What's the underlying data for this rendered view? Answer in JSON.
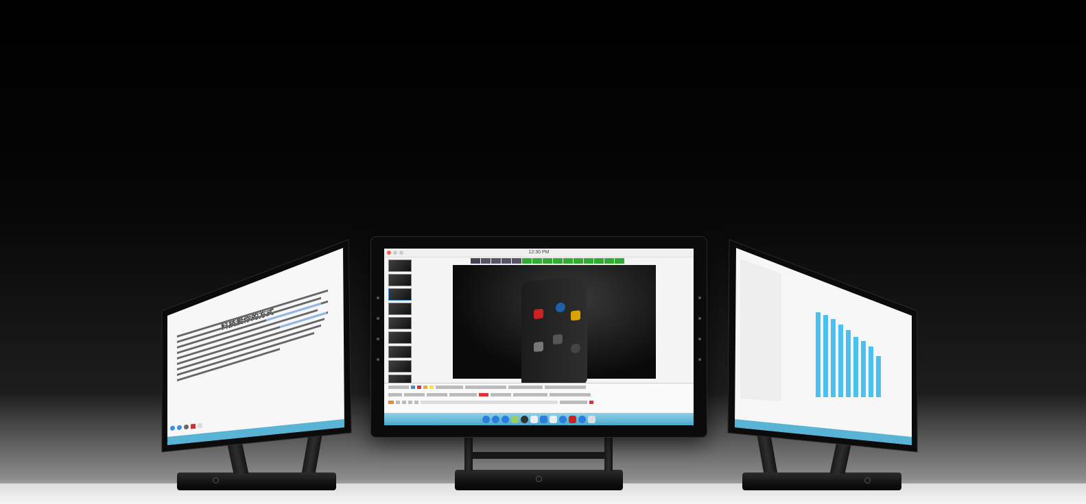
{
  "center_screen": {
    "menubar_time": "12:30 PM",
    "accent": "#4cc0ef"
  },
  "left_screen": {
    "doc_title": "科技爱你的方式"
  },
  "right_screen": {
    "chart_bar_color": "#4cc0ef"
  },
  "dock_icons": [
    "finder-icon",
    "safari-icon",
    "mail-icon",
    "photos-icon",
    "notes-icon",
    "calendar-icon",
    "music-icon",
    "store-icon",
    "settings-icon",
    "trash-icon"
  ],
  "colors": {
    "background": "#000000",
    "dock": "#4ba9cc",
    "bezel": "#0b0b0b"
  }
}
